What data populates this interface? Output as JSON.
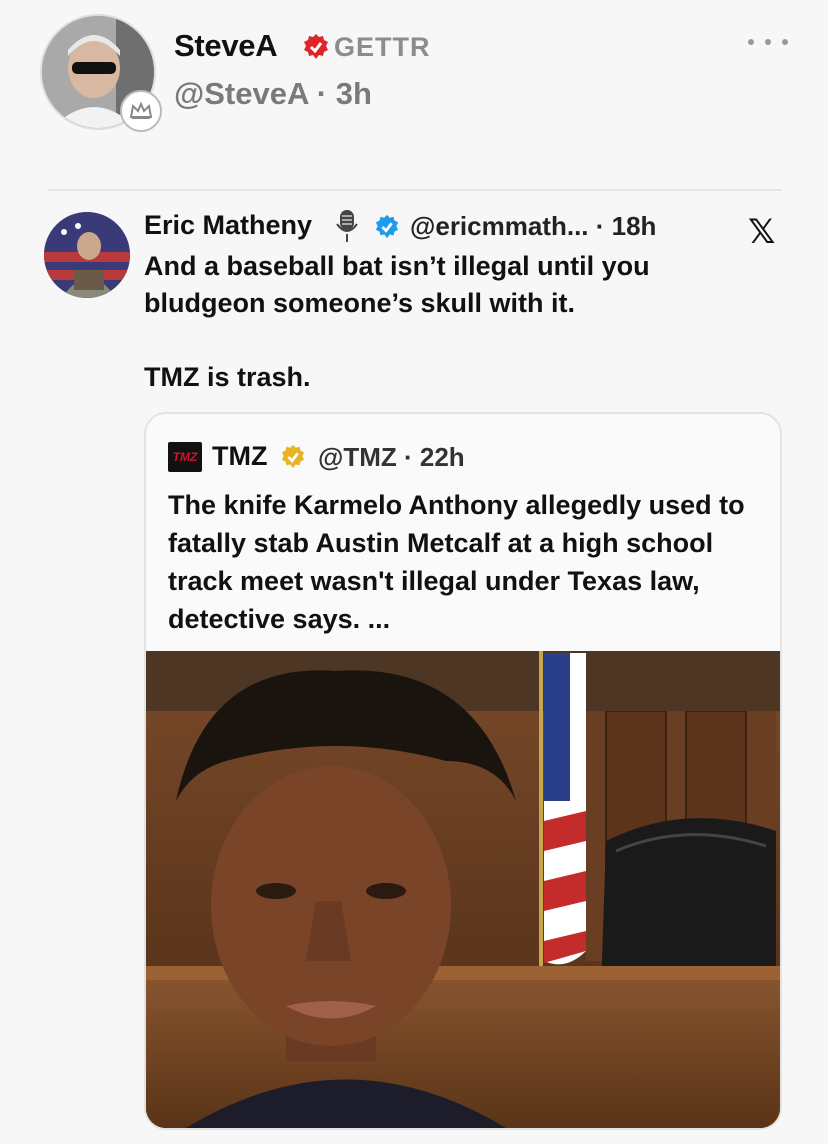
{
  "post": {
    "author_name": "SteveA",
    "platform_label": "GETTR",
    "handle_time": "@SteveA · 3h",
    "avatar_icon": "user-photo",
    "badge_icon": "crown-icon",
    "more_icon": "more-horizontal-icon"
  },
  "embedded_post": {
    "author_name": "Eric Matheny",
    "handle_time": "@ericmmath... · 18h",
    "platform_icon": "x-logo-icon",
    "text_line1": "And a baseball bat isn’t illegal until you bludgeon someone’s skull with it.",
    "text_line2": "TMZ is trash.",
    "quoted": {
      "logo_text": "TMZ",
      "author_name": "TMZ",
      "handle_time": "@TMZ · 22h",
      "text": "The knife Karmelo Anthony allegedly used to fatally stab Austin Metcalf at a high school track meet wasn't illegal under Texas law, detective says. ...",
      "media_description_icon": "photo"
    }
  },
  "colors": {
    "background": "#f7f7f7",
    "gettr_red": "#e0242b",
    "verified_blue": "#1d9bf0",
    "verified_gold": "#e8b323",
    "muted_text": "#7a7a7a"
  }
}
